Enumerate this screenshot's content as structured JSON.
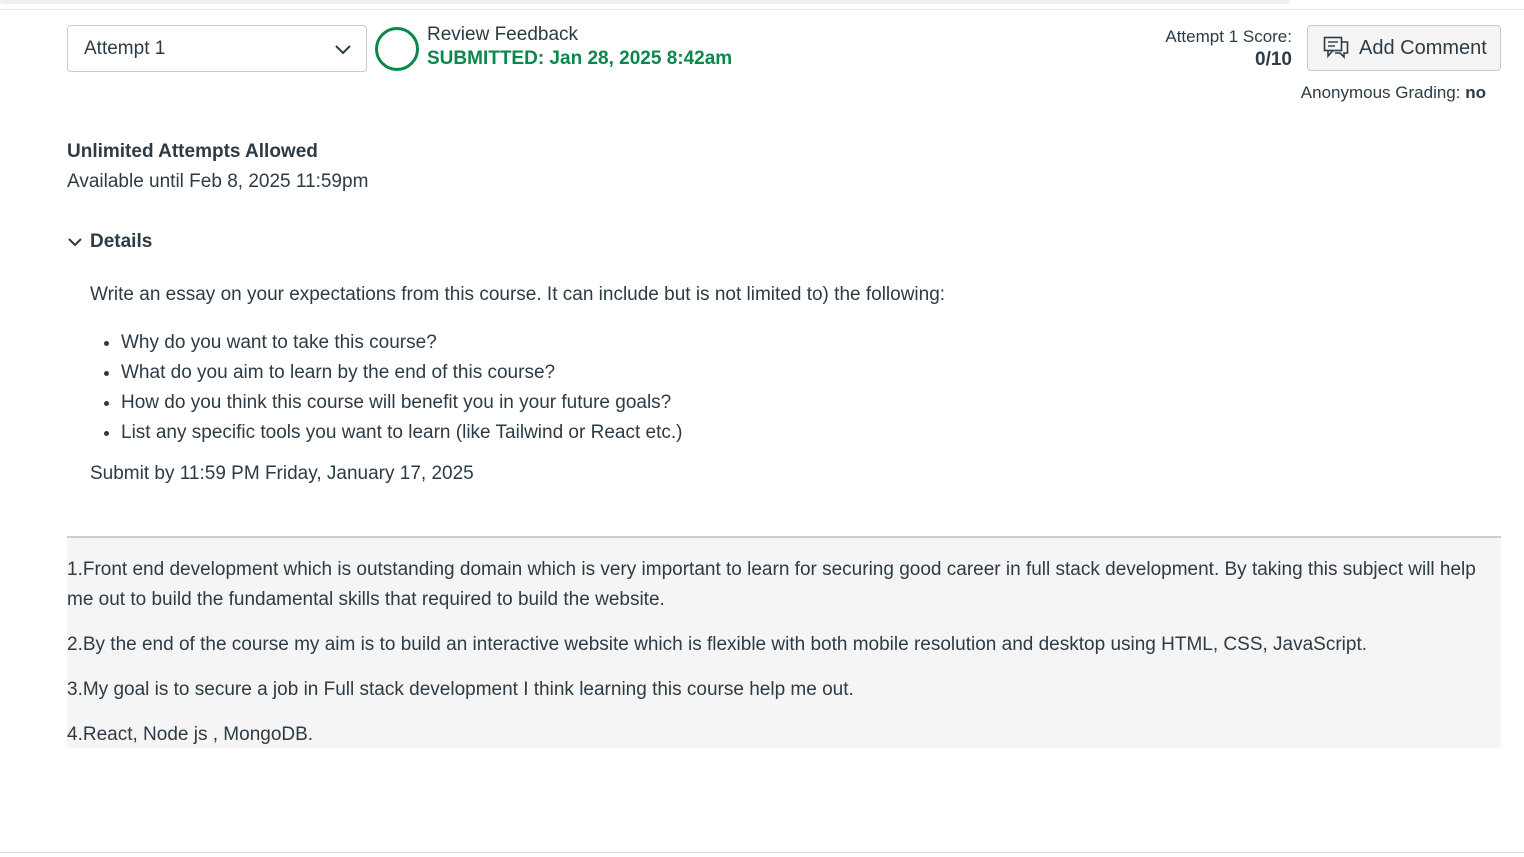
{
  "header": {
    "attempt_select": {
      "value": "Attempt 1"
    },
    "review_feedback": "Review Feedback",
    "submitted": "SUBMITTED: Jan 28, 2025 8:42am",
    "score_label": "Attempt 1 Score:",
    "score_value": "0/10",
    "add_comment_label": "Add Comment",
    "anonymous_label": "Anonymous Grading:",
    "anonymous_value": "no",
    "status_color": "#0b874b"
  },
  "assignment": {
    "attempts": "Unlimited Attempts Allowed",
    "available": "Available until Feb 8, 2025 11:59pm",
    "details_label": "Details",
    "description": "Write an essay on your expectations from this course. It can include but is not limited to) the following:",
    "bullets": [
      "Why do you want to take this course?",
      "What do you aim to learn by the end of this course?",
      "How do you think this course will benefit you in your future goals?",
      "List any specific tools you want to learn (like Tailwind or React etc.)"
    ],
    "submit_by": "Submit by 11:59 PM Friday, January 17, 2025"
  },
  "submission": {
    "paragraphs": [
      "1.Front end development which is outstanding domain which is very important to learn for securing good career in full stack development. By taking this subject will help me out to build the fundamental skills that required to build the website.",
      "2.By the end of the course my aim is to build an interactive website which is flexible with both mobile resolution and desktop using HTML, CSS, JavaScript.",
      "3.My goal is to secure a job in Full stack development I think learning this course help me out.",
      "4.React, Node js , MongoDB."
    ]
  },
  "icons": {
    "attempt_dropdown": "chevron-down-icon",
    "status": "status-ring-icon",
    "comment": "comment-icon",
    "details": "chevron-down-icon"
  }
}
